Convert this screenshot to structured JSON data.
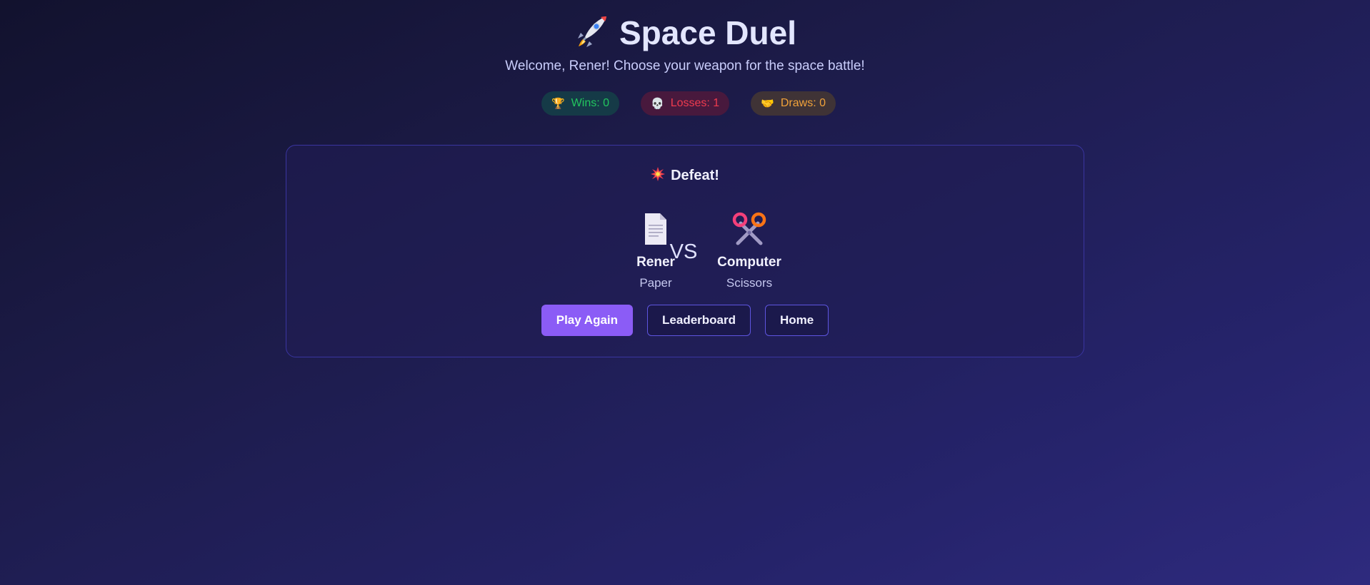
{
  "header": {
    "title": "Space Duel",
    "title_icon": "rocket-icon",
    "subtitle": "Welcome, Rener! Choose your weapon for the space battle!"
  },
  "stats": {
    "wins_label": "Wins: 0",
    "losses_label": "Losses: 1",
    "draws_label": "Draws: 0",
    "wins_icon": "trophy-icon",
    "losses_icon": "skull-icon",
    "draws_icon": "handshake-icon",
    "colors": {
      "wins": "#22c55e",
      "losses": "#ef3b4f",
      "draws": "#f0a23a"
    }
  },
  "result": {
    "icon": "explosion-icon",
    "text": "Defeat!",
    "player": {
      "name": "Rener",
      "choice": "Paper",
      "icon": "paper-icon"
    },
    "vs": "VS",
    "opponent": {
      "name": "Computer",
      "choice": "Scissors",
      "icon": "scissors-icon"
    }
  },
  "actions": {
    "play_again": "Play Again",
    "leaderboard": "Leaderboard",
    "home": "Home"
  },
  "colors": {
    "accent": "#8b5cf6",
    "card_border": "#3a35a0"
  }
}
